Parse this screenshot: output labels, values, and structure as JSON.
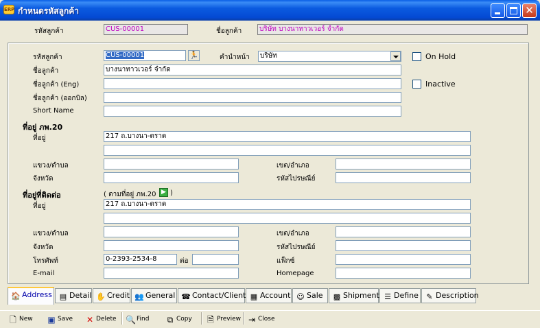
{
  "window": {
    "title": "กำหนดรหัสลูกค้า",
    "app_icon_text": "ERP"
  },
  "header": {
    "code_label": "รหัสลูกค้า",
    "code_value": "CUS-00001",
    "name_label": "ชื่อลูกค้า",
    "name_value": "บริษัท บางนาทาวเวอร์ จำกัด"
  },
  "form": {
    "code_label": "รหัสลูกค้า",
    "code_value": "CUS-00001",
    "prefix_label": "คำนำหน้า",
    "prefix_value": "บริษัท",
    "onhold_label": "On Hold",
    "name_label": "ชื่อลูกค้า",
    "name_value": "บางนาทาวเวอร์ จำกัด",
    "name_eng_label": "ชื่อลูกค้า (Eng)",
    "name_eng_value": "",
    "inactive_label": "Inactive",
    "name_bill_label": "ชื่อลูกค้า (ออกบิล)",
    "name_bill_value": "",
    "short_name_label": "Short Name",
    "short_name_value": ""
  },
  "reg_address": {
    "section_label": "ที่อยู่ ภพ.20",
    "address_label": "ที่อยู่",
    "address_line1": "217 ถ.บางนา-ตราด",
    "address_line2": "",
    "subdistrict_label": "แขวง/ตำบล",
    "subdistrict_value": "",
    "district_label": "เขต/อำเภอ",
    "district_value": "",
    "province_label": "จังหวัด",
    "province_value": "",
    "postcode_label": "รหัสไปรษณีย์",
    "postcode_value": ""
  },
  "contact_address": {
    "section_label": "ที่อยู่ที่ติดต่อ",
    "copy_label_open": "( ตามที่อยู่ ภพ.20",
    "copy_label_close": ")",
    "address_label": "ที่อยู่",
    "address_line1": "217 ถ.บางนา-ตราด",
    "address_line2": "",
    "subdistrict_label": "แขวง/ตำบล",
    "subdistrict_value": "",
    "district_label": "เขต/อำเภอ",
    "district_value": "",
    "province_label": "จังหวัด",
    "province_value": "",
    "postcode_label": "รหัสไปรษณีย์",
    "postcode_value": "",
    "phone_label": "โทรศัพท์",
    "phone_value": "0-2393-2534-8",
    "ext_label": "ต่อ",
    "ext_value": "",
    "fax_label": "แฟ็กซ์",
    "fax_value": "",
    "email_label": "E-mail",
    "email_value": "",
    "homepage_label": "Homepage",
    "homepage_value": ""
  },
  "tabs": [
    {
      "label": "Address",
      "icon": "house-icon",
      "active": true
    },
    {
      "label": "Detail",
      "icon": "detail-icon"
    },
    {
      "label": "Credit",
      "icon": "handshake-icon"
    },
    {
      "label": "General",
      "icon": "people-icon"
    },
    {
      "label": "Contact/Client",
      "icon": "phone-icon"
    },
    {
      "label": "Account",
      "icon": "ledger-icon"
    },
    {
      "label": "Sale",
      "icon": "sale-icon"
    },
    {
      "label": "Shipment",
      "icon": "shipment-icon"
    },
    {
      "label": "Define",
      "icon": "define-icon"
    },
    {
      "label": "Description",
      "icon": "pencil-icon"
    }
  ],
  "toolbar": {
    "new_label": "New",
    "save_label": "Save",
    "delete_label": "Delete",
    "find_label": "Find",
    "copy_label": "Copy",
    "preview_label": "Preview",
    "close_label": "Close"
  }
}
